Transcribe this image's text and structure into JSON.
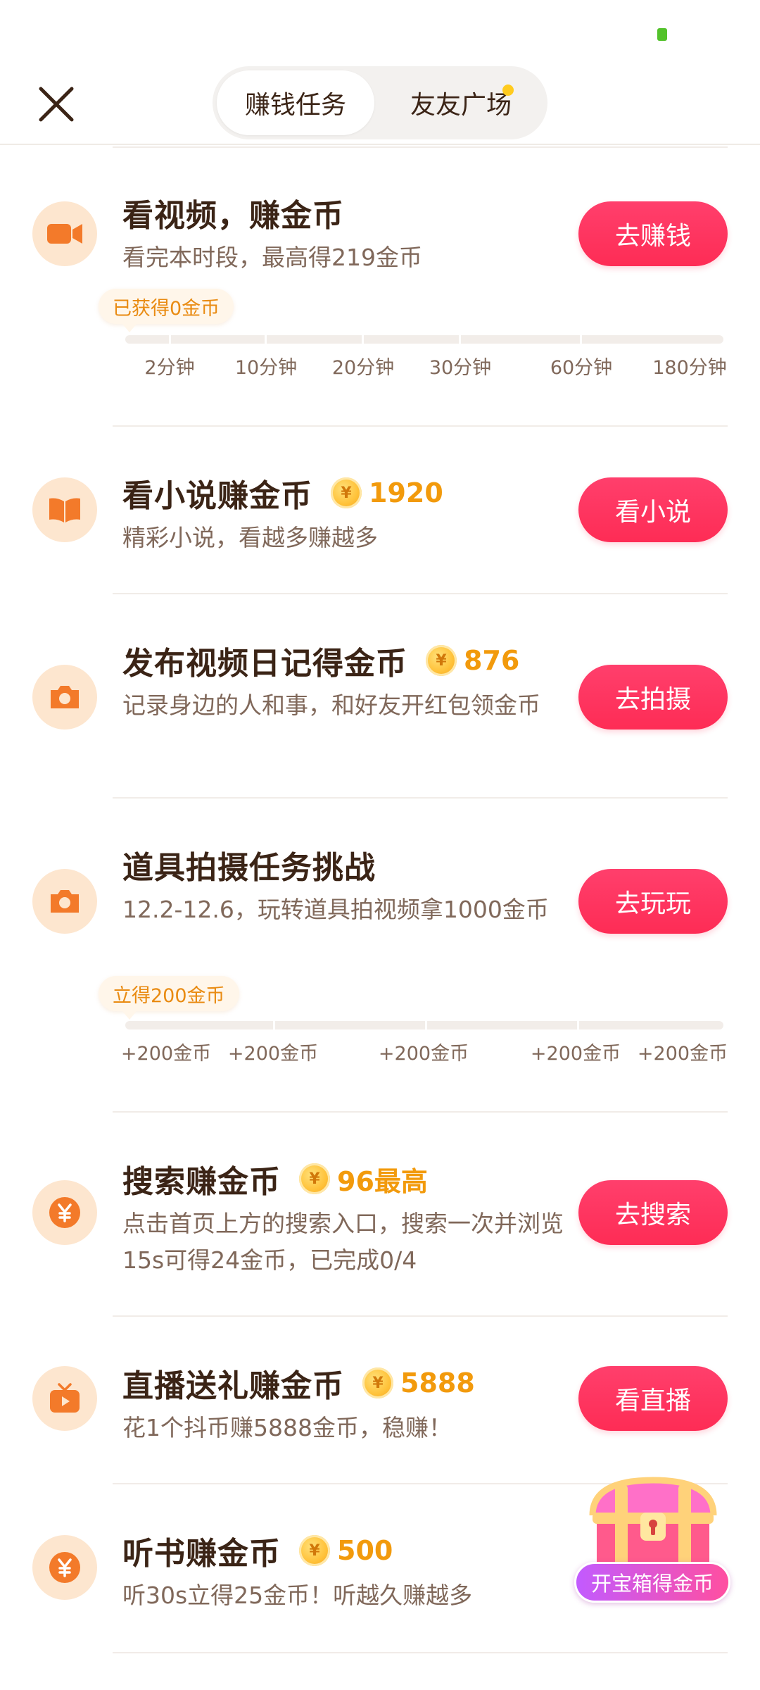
{
  "header": {
    "tabs": [
      {
        "label": "赚钱任务",
        "active": true
      },
      {
        "label": "友友广场",
        "active": false,
        "has_dot": true
      }
    ]
  },
  "tasks": [
    {
      "title": "看视频，赚金币",
      "desc": "看完本时段，最高得219金币",
      "button": "去赚钱",
      "icon": "video-camera-icon",
      "progress": {
        "tip": "已获得0金币",
        "ticks": [
          "2分钟",
          "10分钟",
          "20分钟",
          "30分钟",
          "60分钟",
          "180分钟"
        ]
      }
    },
    {
      "title": "看小说赚金币",
      "reward": "1920",
      "desc": "精彩小说，看越多赚越多",
      "button": "看小说",
      "icon": "book-icon"
    },
    {
      "title": "发布视频日记得金币",
      "reward": "876",
      "desc": "记录身边的人和事，和好友开红包领金币",
      "button": "去拍摄",
      "icon": "camera-icon"
    },
    {
      "title": "道具拍摄任务挑战",
      "desc": "12.2-12.6，玩转道具拍视频拿1000金币",
      "button": "去玩玩",
      "icon": "camera-icon",
      "progress": {
        "tip": "立得200金币",
        "ticks": [
          "+200金币",
          "+200金币",
          "+200金币",
          "+200金币",
          "+200金币"
        ]
      }
    },
    {
      "title": "搜索赚金币",
      "reward": "96最高",
      "desc": "点击首页上方的搜索入口，搜索一次并浏览15s可得24金币，已完成0/4",
      "button": "去搜索",
      "icon": "yuan-coin-icon"
    },
    {
      "title": "直播送礼赚金币",
      "reward": "5888",
      "desc": "花1个抖币赚5888金币，稳赚！",
      "button": "看直播",
      "icon": "tv-play-icon"
    },
    {
      "title": "听书赚金币",
      "reward": "500",
      "desc": "听30s立得25金币！听越久赚越多",
      "icon": "yuan-coin-icon"
    }
  ],
  "coin_symbol": "¥",
  "treasure": {
    "label": "开宝箱得金币"
  },
  "colors": {
    "accent_button": "#fe2c55",
    "reward_orange": "#f29a0c",
    "icon_orange": "#f37a2a",
    "icon_bg": "#fde6cf",
    "title_brown": "#3b2416"
  }
}
